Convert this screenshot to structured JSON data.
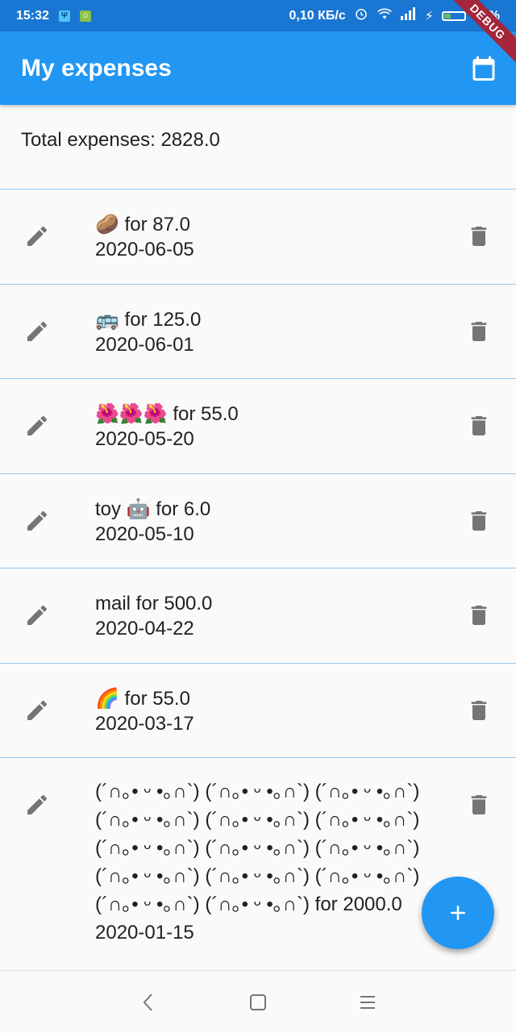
{
  "status_bar": {
    "time": "15:32",
    "network_speed": "0,10 КБ/с",
    "battery_percent": "29%",
    "battery_level": 0.29,
    "debug_label": "DEBUG"
  },
  "app_bar": {
    "title": "My expenses",
    "action_icon": "calendar-icon"
  },
  "summary": {
    "total_text": "Total expenses: 2828.0"
  },
  "expenses": [
    {
      "description": "🥔 for 87.0",
      "date": "2020-06-05"
    },
    {
      "description": "🚌 for 125.0",
      "date": "2020-06-01"
    },
    {
      "description": "🌺🌺🌺 for 55.0",
      "date": "2020-05-20"
    },
    {
      "description": "toy 🤖 for 6.0",
      "date": "2020-05-10"
    },
    {
      "description": "mail for 500.0",
      "date": "2020-04-22"
    },
    {
      "description": "🌈 for 55.0",
      "date": "2020-03-17"
    },
    {
      "description": "(´∩｡• ᵕ •｡∩`) (´∩｡• ᵕ •｡∩`) (´∩｡• ᵕ •｡∩`) (´∩｡• ᵕ •｡∩`) (´∩｡• ᵕ •｡∩`) (´∩｡• ᵕ •｡∩`) (´∩｡• ᵕ •｡∩`) (´∩｡• ᵕ •｡∩`) (´∩｡• ᵕ •｡∩`) (´∩｡• ᵕ •｡∩`) (´∩｡• ᵕ •｡∩`) (´∩｡• ᵕ •｡∩`) (´∩｡• ᵕ •｡∩`) (´∩｡• ᵕ •｡∩`)  for 2000.0",
      "date": "2020-01-15"
    }
  ],
  "fab": {
    "icon": "plus-icon"
  },
  "nav_bar": {
    "back_icon": "back-icon",
    "home_icon": "home-icon",
    "menu_icon": "menu-icon"
  },
  "colors": {
    "primary": "#2196F3",
    "status_bar": "#1976D2",
    "divider": "#90caf9",
    "icon_grey": "#757575",
    "debug_ribbon": "#a5263a"
  }
}
